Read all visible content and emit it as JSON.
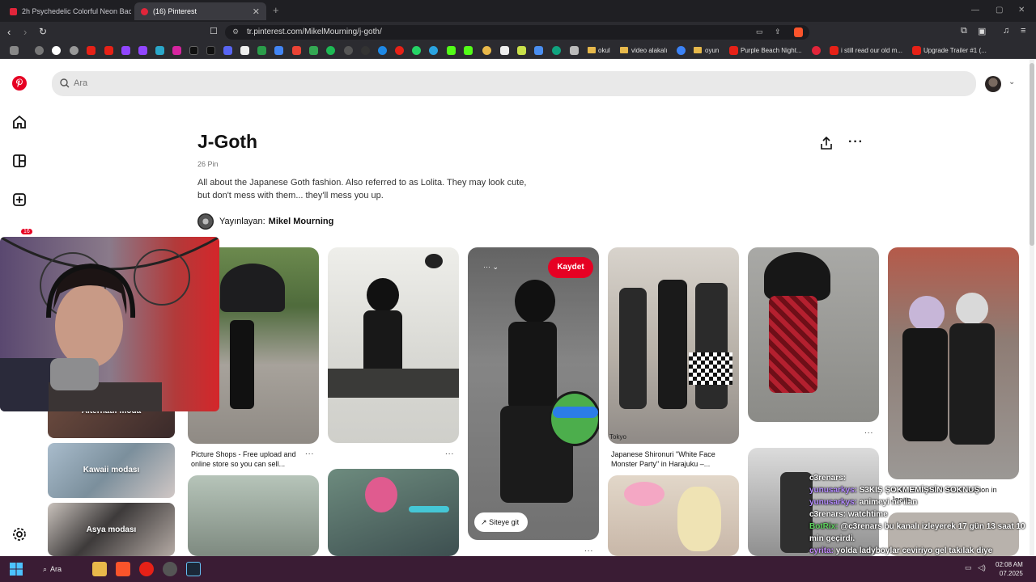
{
  "browser": {
    "tabs": [
      {
        "label": "2h Psychedelic Colorful Neon Backgr",
        "active": false
      },
      {
        "label": "(16) Pinterest",
        "active": true
      }
    ],
    "url": "tr.pinterest.com/MikelMourning/j-goth/",
    "bookmarks": [
      "okul",
      "video alakalı",
      "oyun",
      "Purple Beach Night...",
      "i still read our old m...",
      "Upgrade Trailer #1 (..."
    ]
  },
  "pinterest": {
    "search_placeholder": "Ara",
    "notification_count": "16",
    "board": {
      "title": "J-Goth",
      "pin_count": "26 Pin",
      "description": "All about the Japanese Goth fashion. Also referred to as Lolita. They may look cute, but don't mess with them... they'll mess you up.",
      "publisher_prefix": "Yayınlayan:",
      "publisher_name": "Mikel Mourning"
    },
    "pins": [
      {
        "caption": "Picture Shops - Free upload and online store so you can sell..."
      },
      {
        "caption": "Japanese Shironuri \"White Face Monster Party\" in Harajuku –..."
      },
      {
        "caption": "Halloween 2010 street fashion in"
      },
      {
        "caption": "Japan"
      }
    ],
    "pin_watermark": "Tokyo",
    "save_button": "Kaydet",
    "visit_button": "Siteye git",
    "more": "...",
    "side_boards": [
      "Alternatif moda",
      "Kawaii modası",
      "Asya modası"
    ]
  },
  "chat": [
    {
      "user": "c3renars:",
      "text": "",
      "color": "#ffffff"
    },
    {
      "user": "yunusarkys:",
      "text": "S3KIŞ ŞOKMEMİŞSİN SOKNUŞ",
      "color": "#b58cff"
    },
    {
      "user": "yunusarkys:",
      "text": "animeyi ne ilan",
      "color": "#b58cff"
    },
    {
      "user": "c3renars:",
      "text": "watchtime",
      "color": "#ffffff"
    },
    {
      "user": "BotRix:",
      "text": "@c3renars bu kanalı izleyerek 17 gün 13 saat 10 min geçirdi.",
      "color": "#5fd35f"
    },
    {
      "user": "cyrita:",
      "text": "yolda ladyboylar ceviriyo gel takılak diye",
      "color": "#c58bff"
    }
  ],
  "taskbar": {
    "search": "Ara",
    "time": "02:08 AM",
    "date": "07.2025"
  },
  "colors": {
    "pinterest_red": "#e60023"
  }
}
